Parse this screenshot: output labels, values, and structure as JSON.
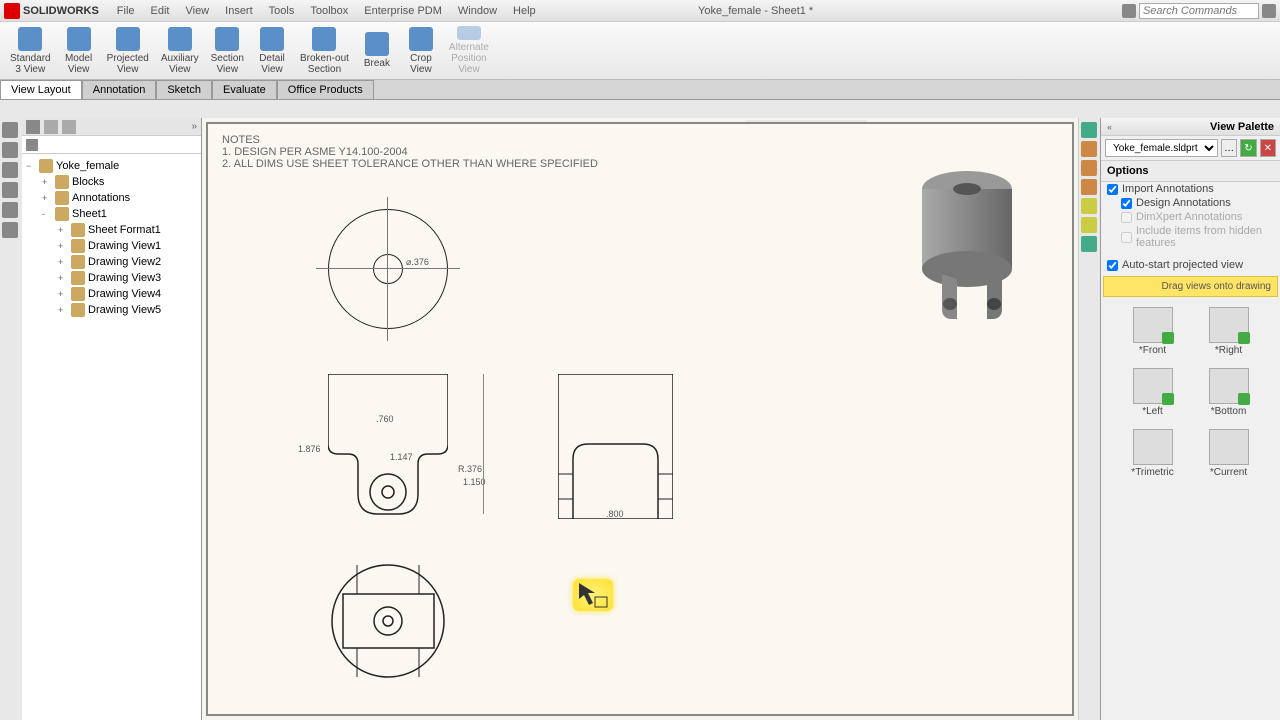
{
  "app_name": "SOLIDWORKS",
  "document_title": "Yoke_female - Sheet1 *",
  "menus": [
    "File",
    "Edit",
    "View",
    "Insert",
    "Tools",
    "Toolbox",
    "Enterprise PDM",
    "Window",
    "Help"
  ],
  "search_placeholder": "Search Commands",
  "ribbon": [
    {
      "label": "Standard\n3 View"
    },
    {
      "label": "Model\nView"
    },
    {
      "label": "Projected\nView"
    },
    {
      "label": "Auxiliary\nView"
    },
    {
      "label": "Section\nView"
    },
    {
      "label": "Detail\nView"
    },
    {
      "label": "Broken-out\nSection"
    },
    {
      "label": "Break"
    },
    {
      "label": "Crop\nView"
    },
    {
      "label": "Alternate\nPosition\nView",
      "disabled": true
    }
  ],
  "tabs": [
    "View Layout",
    "Annotation",
    "Sketch",
    "Evaluate",
    "Office Products"
  ],
  "active_tab": "View Layout",
  "tree": {
    "root": "Yoke_female",
    "items": [
      {
        "label": "Blocks",
        "indent": 1,
        "exp": "+"
      },
      {
        "label": "Annotations",
        "indent": 1,
        "exp": "+"
      },
      {
        "label": "Sheet1",
        "indent": 1,
        "exp": "-"
      },
      {
        "label": "Sheet Format1",
        "indent": 2,
        "exp": "+"
      },
      {
        "label": "Drawing View1",
        "indent": 2,
        "exp": "+"
      },
      {
        "label": "Drawing View2",
        "indent": 2,
        "exp": "+"
      },
      {
        "label": "Drawing View3",
        "indent": 2,
        "exp": "+"
      },
      {
        "label": "Drawing View4",
        "indent": 2,
        "exp": "+"
      },
      {
        "label": "Drawing View5",
        "indent": 2,
        "exp": "+"
      }
    ]
  },
  "notes": {
    "heading": "NOTES",
    "line1": "1.        DESIGN PER ASME Y14.100-2004",
    "line2": "2.        ALL DIMS USE SHEET TOLERANCE OTHER THAN WHERE SPECIFIED"
  },
  "dims": {
    "top_dia": "⌀.376",
    "front_w": ".760",
    "front_h": "1.876",
    "front_r1": "1.147",
    "front_r2": "R.376",
    "front_d": "1.150",
    "right_w": ".800"
  },
  "palette": {
    "title": "View Palette",
    "model": "Yoke_female.sldprt",
    "options_label": "Options",
    "import_annotations": "Import Annotations",
    "design_annotations": "Design Annotations",
    "dimxpert": "DimXpert Annotations",
    "hidden": "Include items from hidden features",
    "auto_start": "Auto-start projected view",
    "drag_hint": "Drag views onto drawing",
    "views": [
      "*Front",
      "*Right",
      "*Left",
      "*Bottom",
      "*Trimetric",
      "*Current"
    ]
  }
}
